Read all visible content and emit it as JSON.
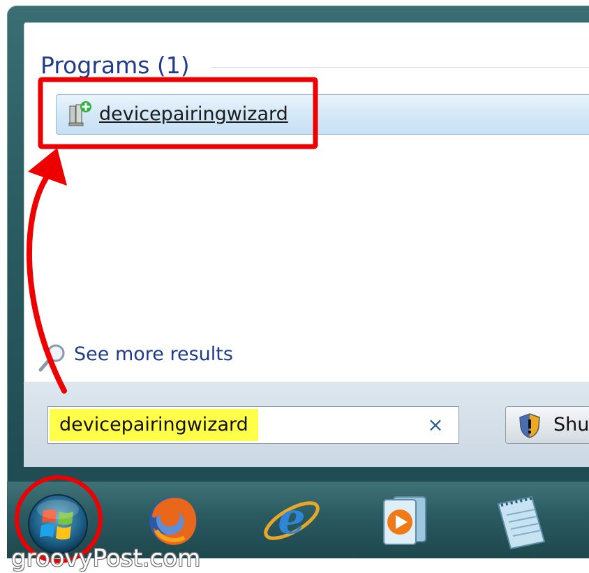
{
  "start_menu": {
    "section_title": "Programs (1)",
    "results": [
      {
        "label": "devicepairingwizard",
        "icon": "device-pairing-icon"
      }
    ],
    "see_more_label": "See more results",
    "search": {
      "value": "devicepairingwizard",
      "clear_symbol": "×"
    },
    "shutdown_label": "Shu"
  },
  "taskbar": {
    "items": [
      {
        "name": "start-orb",
        "icon": "windows-logo-icon"
      },
      {
        "name": "firefox",
        "icon": "firefox-icon"
      },
      {
        "name": "internet-explorer",
        "icon": "internet-explorer-icon"
      },
      {
        "name": "windows-media-player",
        "icon": "media-player-icon"
      },
      {
        "name": "notepad",
        "icon": "notepad-icon"
      }
    ]
  },
  "watermark": "groovyPost.com",
  "colors": {
    "annotation_red": "#ee0000",
    "highlight_yellow": "#ffff4a",
    "link_blue": "#1e3c8a"
  }
}
